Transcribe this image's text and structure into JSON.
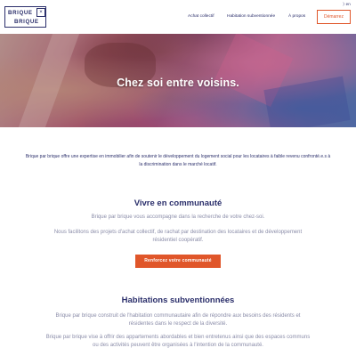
{
  "header": {
    "logo": {
      "word1": "BRIQUE",
      "word2": "BRIQUE",
      "symbol": "×"
    },
    "lang": "⟩ en",
    "nav": [
      {
        "label": "Achat collectif"
      },
      {
        "label": "Habitation subventionnée"
      },
      {
        "label": "À propos"
      }
    ],
    "cta_label": "Démarrez"
  },
  "hero": {
    "title": "Chez soi entre voisins."
  },
  "intro": "Brique par brique offre une expertise en immobilier afin de soutenir le développement du logement social pour les locataires à faible revenu confronté.e.s à la discrimination dans le marché locatif.",
  "vivre": {
    "title": "Vivre en communauté",
    "p1": "Brique par brique vous accompagne dans la recherche de votre chez-soi.",
    "p2": "Nous facilitons des projets d'achat collectif, de rachat par destination des locataires et de développement résidentiel coopératif.",
    "cta_label": "Renforcez votre communauté"
  },
  "habitations": {
    "title": "Habitations subventionnées",
    "p1": "Brique par brique construit de l'habitation communautaire afin de répondre aux besoins des résidents et résidentes dans le respect de la diversité.",
    "p2": "Brique par brique vise à offrir des appartements abordables et bien entretenus ainsi que des espaces communs ou des activités peuvent être organisées à l'intention de la communauté."
  },
  "colors": {
    "brand": "#2b2f6b",
    "accent": "#e0562a",
    "muted": "#8a8ca8"
  }
}
